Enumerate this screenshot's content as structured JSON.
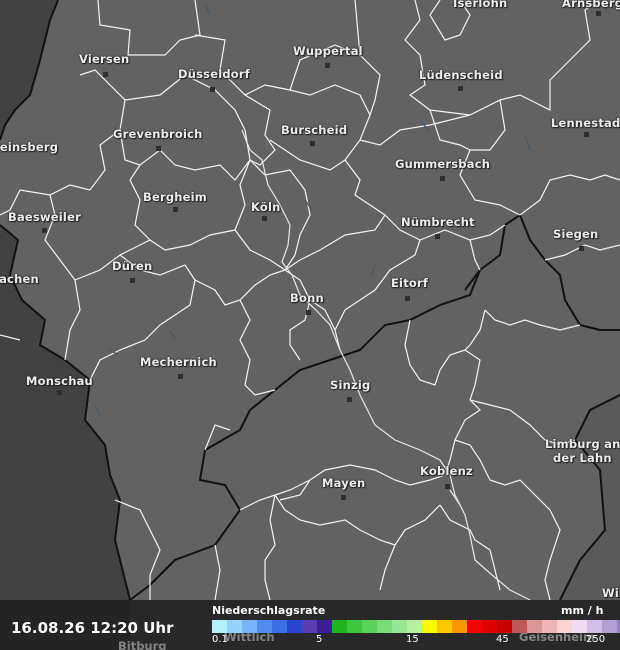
{
  "map": {
    "cities": [
      {
        "id": "iserlohn",
        "name": "Iserlohn"
      },
      {
        "id": "arnsberg",
        "name": "Arnsberg"
      },
      {
        "id": "viersen",
        "name": "Viersen"
      },
      {
        "id": "wuppertal",
        "name": "Wuppertal"
      },
      {
        "id": "duesseldorf",
        "name": "Düsseldorf"
      },
      {
        "id": "luedenscheid",
        "name": "Lüdenscheid"
      },
      {
        "id": "lennestadt",
        "name": "Lennestadt"
      },
      {
        "id": "grevenbroich",
        "name": "Grevenbroich"
      },
      {
        "id": "burscheid",
        "name": "Burscheid"
      },
      {
        "id": "heinsberg",
        "name": "Heinsberg"
      },
      {
        "id": "gummersbach",
        "name": "Gummersbach"
      },
      {
        "id": "bergheim",
        "name": "Bergheim"
      },
      {
        "id": "koeln",
        "name": "Köln"
      },
      {
        "id": "baesweiler",
        "name": "Baesweiler"
      },
      {
        "id": "nuembrecht",
        "name": "Nümbrecht"
      },
      {
        "id": "siegen",
        "name": "Siegen"
      },
      {
        "id": "dueren",
        "name": "Düren"
      },
      {
        "id": "aachen",
        "name": "Aachen"
      },
      {
        "id": "eitorf",
        "name": "Eitorf"
      },
      {
        "id": "bonn",
        "name": "Bonn"
      },
      {
        "id": "mechernich",
        "name": "Mechernich"
      },
      {
        "id": "monschau",
        "name": "Monschau"
      },
      {
        "id": "sinzig",
        "name": "Sinzig"
      },
      {
        "id": "limburg",
        "name": "Limburg an der Lahn",
        "line1": "Limburg an",
        "line2": "der Lahn"
      },
      {
        "id": "koblenz",
        "name": "Koblenz"
      },
      {
        "id": "mayen",
        "name": "Mayen"
      },
      {
        "id": "wittlich",
        "name": "Wittlich"
      },
      {
        "id": "bitburg",
        "name": "Bitburg"
      },
      {
        "id": "geisenheim",
        "name": "Geisenheim"
      },
      {
        "id": "wi",
        "name": "Wi"
      }
    ]
  },
  "footer": {
    "timestamp": "16.08.26 12:20 Uhr",
    "legend_title": "Niederschlagsrate",
    "legend_unit": "mm / h",
    "ticks": [
      "0.1",
      "5",
      "15",
      "45",
      "250"
    ]
  },
  "legend_colors": [
    "#b4f0fa",
    "#96d2fa",
    "#78b4fa",
    "#508cf0",
    "#3c6ee6",
    "#2846d2",
    "#5a3cb4",
    "#3c1e96",
    "#1eb41e",
    "#3cc83c",
    "#5ad25a",
    "#78dc78",
    "#96e696",
    "#b4f0a0",
    "#fafa00",
    "#fac800",
    "#fa9600",
    "#fa0000",
    "#dc0000",
    "#c80000",
    "#be5a5a",
    "#dc9696",
    "#f0b4b4",
    "#fad2d2",
    "#f0dcf0",
    "#d2bee6",
    "#b4a0d2",
    "#9682be"
  ]
}
